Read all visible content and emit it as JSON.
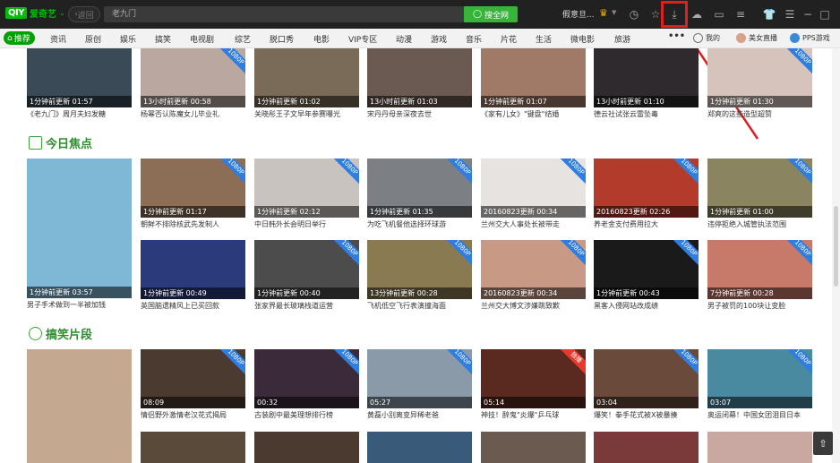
{
  "app": {
    "logo_badge": "QIY",
    "brand": "爱奇艺",
    "back_label": "返回"
  },
  "search": {
    "value": "老九门",
    "button_label": "搜全网"
  },
  "user": {
    "name": "假意旦..."
  },
  "nav": {
    "home": "推荐",
    "items": [
      "资讯",
      "原创",
      "娱乐",
      "搞笑",
      "电视剧",
      "综艺",
      "脱口秀",
      "电影",
      "VIP专区",
      "动漫",
      "游戏",
      "音乐",
      "片花",
      "生活",
      "微电影",
      "旅游"
    ],
    "more": "•••",
    "mine": "我的",
    "live": "美女直播",
    "pps": "PPS游戏"
  },
  "row0": [
    {
      "overlay": "1分钟前更新 01:57",
      "caption": "《老九门》周月夫妇发糖",
      "badge": "",
      "color": "#3a4a56"
    },
    {
      "overlay": "13小时前更新 00:58",
      "caption": "杨幂否认陈魔女儿毕业礼",
      "badge": "1080P",
      "color": "#b9a7a0"
    },
    {
      "overlay": "1分钟前更新 01:02",
      "caption": "关晓彤王子文早年参赛曝光",
      "badge": "",
      "color": "#7a6a58"
    },
    {
      "overlay": "13小时前更新 01:03",
      "caption": "宋丹丹母亲深夜去世",
      "badge": "",
      "color": "#6b5a52"
    },
    {
      "overlay": "1分钟前更新 01:07",
      "caption": "《家有儿女》\"键盘\"结婚",
      "badge": "",
      "color": "#a07a66"
    },
    {
      "overlay": "13小时前更新 01:10",
      "caption": "德云社试张云雷坠毒",
      "badge": "",
      "color": "#2e2a2e"
    },
    {
      "overlay": "1分钟前更新 01:30",
      "caption": "郑爽的这些造型超赞",
      "badge": "1080P",
      "color": "#d6c4bc"
    }
  ],
  "section_focus": "今日焦点",
  "focus_tall": {
    "overlay": "1分钟前更新 03:57",
    "caption": "男子手术做到一半被加钱",
    "color": "#7fb7d6"
  },
  "focus_row1": [
    {
      "overlay": "1分钟前更新 01:17",
      "caption": "朝鲜不排除核武先发制人",
      "badge": "1080P",
      "color": "#8b6e55"
    },
    {
      "overlay": "1分钟前更新 02:12",
      "caption": "中日韩外长会明日举行",
      "badge": "1080P",
      "color": "#c9c3c0"
    },
    {
      "overlay": "1分钟前更新 01:35",
      "caption": "为吃飞机餐他选择环球游",
      "badge": "1080P",
      "color": "#7c7f84"
    },
    {
      "overlay": "20160823更新 00:34",
      "caption": "兰州交大人事处长被带走",
      "badge": "1080P",
      "color": "#e6e3e0"
    },
    {
      "overlay": "20160823更新 02:26",
      "caption": "养老金支付费用拉大",
      "badge": "1080P",
      "color": "#b23b2c"
    },
    {
      "overlay": "1分钟前更新 01:00",
      "caption": "违停拒绝入城管执法范围",
      "badge": "1080P",
      "color": "#8a8560"
    }
  ],
  "focus_row2": [
    {
      "overlay": "1分钟前更新 00:49",
      "caption": "英国脑遗精风上已买回款",
      "badge": "",
      "color": "#2a3a7a"
    },
    {
      "overlay": "1分钟前更新 00:40",
      "caption": "张家界最长玻璃栈道运营",
      "badge": "1080P",
      "color": "#4c4c4c"
    },
    {
      "overlay": "13分钟前更新 00:28",
      "caption": "飞机低空飞行表演撞海面",
      "badge": "1080P",
      "color": "#8a7a52"
    },
    {
      "overlay": "20160823更新 00:34",
      "caption": "兰州交大博文涉嫌跳致歉",
      "badge": "1080P",
      "color": "#c89a86"
    },
    {
      "overlay": "1分钟前更新 00:43",
      "caption": "黑客入侵网站改成绩",
      "badge": "1080P",
      "color": "#1a1a1a"
    },
    {
      "overlay": "7分钟前更新 00:28",
      "caption": "男子被罚的100块让变脸",
      "badge": "1080P",
      "color": "#c87a6a"
    }
  ],
  "section_funny": "搞笑片段",
  "funny_tall": {
    "color": "#c4a890"
  },
  "funny_row1": [
    {
      "overlay": "08:09",
      "caption": "情侣野外激情老汉花式揭局",
      "badge": "1080P",
      "color": "#4a3a30"
    },
    {
      "overlay": "00:32",
      "caption": "古装剧中最美理想排行榜",
      "badge": "1080P",
      "color": "#3a2a3a"
    },
    {
      "overlay": "05:27",
      "caption": "黄磊小别离变异稀老爸",
      "badge": "1080P",
      "color": "#8a9aa8"
    },
    {
      "overlay": "05:14",
      "caption": "神技！醉鬼\"炎爆\"乒乓球",
      "badge": "独播",
      "color": "#5a2a20"
    },
    {
      "overlay": "03:04",
      "caption": "爆笑！拳手花式被X被暴揍",
      "badge": "1080P",
      "color": "#6a4a3a"
    },
    {
      "overlay": "03:07",
      "caption": "奥运闭幕！中国女团泪目日本",
      "badge": "1080P",
      "color": "#4a8aa0"
    }
  ],
  "funny_row2_colors": [
    "#5a4a3a",
    "#4a3a30",
    "#3a5a7a",
    "#6a5a50",
    "#7a3a3a",
    "#c8a8a0"
  ]
}
